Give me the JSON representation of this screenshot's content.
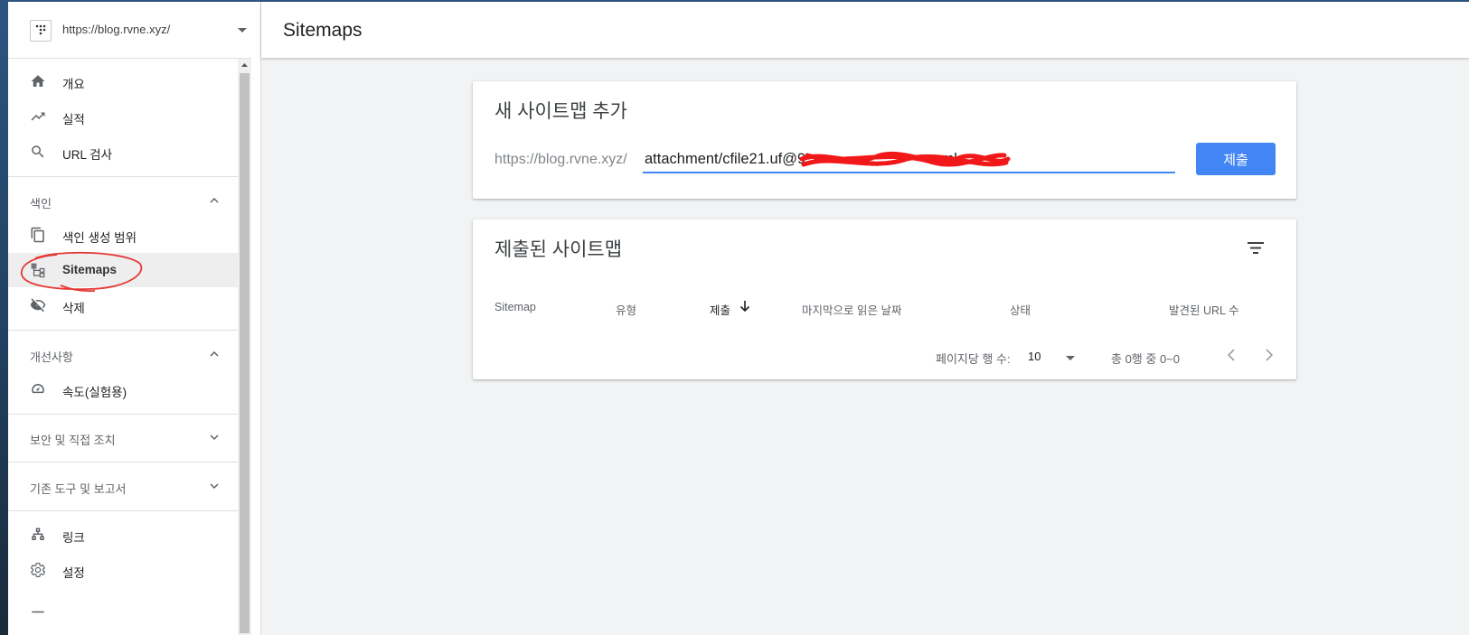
{
  "property": {
    "url": "https://blog.rvne.xyz/"
  },
  "nav": {
    "overview": "개요",
    "performance": "실적",
    "url_inspection": "URL 검사",
    "index_section": "색인",
    "coverage": "색인 생성 범위",
    "sitemaps": "Sitemaps",
    "removals": "삭제",
    "enhancements_section": "개선사항",
    "speed": "속도(실험용)",
    "security_section": "보안 및 직접 조치",
    "legacy_section": "기존 도구 및 보고서",
    "links": "링크",
    "settings": "설정"
  },
  "header": {
    "title": "Sitemaps"
  },
  "add_sitemap": {
    "title": "새 사이트맵 추가",
    "prefix": "https://blog.rvne.xyz/",
    "input_value": "attachment/cfile21.uf@9                              .xml",
    "submit_label": "제출"
  },
  "submitted": {
    "title": "제출된 사이트맵",
    "columns": [
      "Sitemap",
      "유형",
      "제출",
      "마지막으로 읽은 날짜",
      "상태",
      "발견된 URL 수"
    ],
    "rows_per_page_label": "페이지당 행 수:",
    "rows_per_page_value": "10",
    "range_text": "총 0행 중 0~0"
  },
  "colors": {
    "accent": "#4285f4",
    "annotation": "#e53935"
  },
  "icons": [
    "home-icon",
    "trending-icon",
    "search-icon",
    "copy-icon",
    "sitemap-icon",
    "visibility-off-icon",
    "gauge-icon",
    "links-icon",
    "gear-icon",
    "filter-icon",
    "arrow-down-icon",
    "chevron-left-icon",
    "chevron-right-icon"
  ]
}
